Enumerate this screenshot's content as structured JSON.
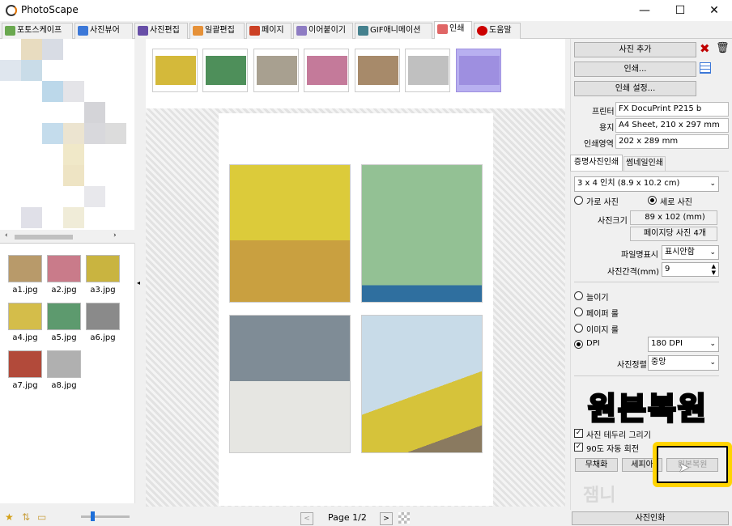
{
  "window": {
    "title": "PhotoScape",
    "minimize": "—",
    "maximize": "☐",
    "close": "✕"
  },
  "tabs": [
    {
      "label": "포토스케이프",
      "color": "#6aa84f"
    },
    {
      "label": "사진뷰어",
      "color": "#3c78d8"
    },
    {
      "label": "사진편집",
      "color": "#674ea7"
    },
    {
      "label": "일괄편집",
      "color": "#e69138"
    },
    {
      "label": "페이지",
      "color": "#cc4125"
    },
    {
      "label": "이어붙이기",
      "color": "#8e7cc3"
    },
    {
      "label": "GIF애니메이션",
      "color": "#45818e"
    },
    {
      "label": "인쇄",
      "color": "#e06666"
    },
    {
      "label": "도움말",
      "color": "#cc0000"
    }
  ],
  "files": [
    {
      "name": "a1.jpg",
      "color": "#b89a6a"
    },
    {
      "name": "a2.jpg",
      "color": "#c97b8a"
    },
    {
      "name": "a3.jpg",
      "color": "#c9b440"
    },
    {
      "name": "a4.jpg",
      "color": "#d4bd4a"
    },
    {
      "name": "a5.jpg",
      "color": "#5d9a6e"
    },
    {
      "name": "a6.jpg",
      "color": "#8a8a8a"
    },
    {
      "name": "a7.jpg",
      "color": "#b24a3a"
    },
    {
      "name": "a8.jpg",
      "color": "#b0b0b0"
    }
  ],
  "strip": [
    {
      "color": "#d4b93a"
    },
    {
      "color": "#4e8f5a"
    },
    {
      "color": "#a8a090"
    },
    {
      "color": "#c47a9a"
    },
    {
      "color": "#a78a6a"
    },
    {
      "color": "#c0c0c0"
    },
    {
      "color": "#9e8fe0"
    }
  ],
  "preview": {
    "page_label": "Page 1/2",
    "prev": "<",
    "next": ">",
    "photos": [
      {
        "color": "#d8c53a"
      },
      {
        "color": "#93c194"
      },
      {
        "color": "#8a96a0"
      },
      {
        "color": "#c8dbe8"
      }
    ]
  },
  "right": {
    "add_photo": "사진 추가",
    "print": "인쇄...",
    "print_setup": "인쇄 설정...",
    "printer_label": "프린터",
    "printer_value": "FX DocuPrint P215 b",
    "paper_label": "용지",
    "paper_value": "A4 Sheet, 210 x 297 mm",
    "area_label": "인쇄영역",
    "area_value": "202 x 289 mm",
    "tab_photo": "증명사진인쇄",
    "tab_thumb": "썸네일인쇄",
    "size_select": "3 x 4 인치 (8.9 x 10.2 cm)",
    "landscape": "가로 사진",
    "portrait": "세로 사진",
    "photo_size_label": "사진크기",
    "photo_size_value": "89 x 102 (mm)",
    "per_page": "페이지당 사진 4개",
    "filename_label": "파일명표시",
    "filename_value": "표시안함",
    "gap_label": "사진간격(mm)",
    "gap_value": "9",
    "opt_stretch": "늘이기",
    "opt_paper": "페이퍼 룰",
    "opt_image": "이미지 룰",
    "opt_dpi": "DPI",
    "dpi_value": "180 DPI",
    "align_label": "사진정렬",
    "align_value": "중앙",
    "border_check": "사진 테두리 그리기",
    "rotate_check": "90도 자동 회전",
    "btn_desat": "무채화",
    "btn_sepia": "세피아",
    "btn_restore": "원본복원",
    "btn_bottom": "사진인화"
  },
  "overlay": {
    "big_text": "원본복원",
    "watermark": "잼니"
  },
  "colors": {
    "accent_yellow": "#ffd400",
    "remove_icon": "#c00000"
  }
}
